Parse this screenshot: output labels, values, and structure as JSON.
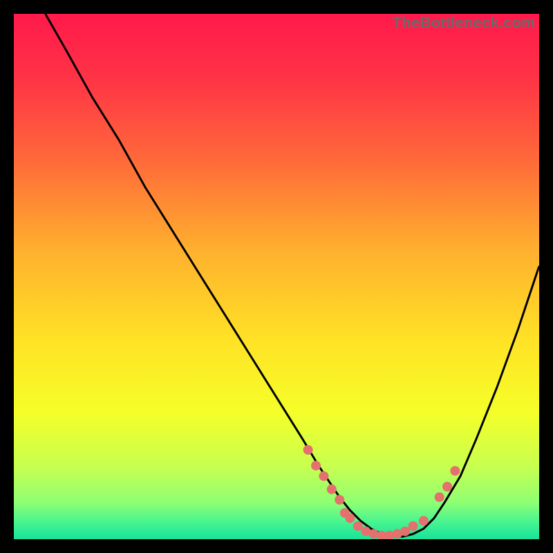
{
  "watermark": "TheBottleneck.com",
  "colors": {
    "background": "#000000",
    "curve": "#000000",
    "dots": "#e4716e",
    "gradient_stops": [
      {
        "offset": 0.0,
        "color": "#ff1a4b"
      },
      {
        "offset": 0.12,
        "color": "#ff3246"
      },
      {
        "offset": 0.28,
        "color": "#ff6a3a"
      },
      {
        "offset": 0.45,
        "color": "#ffb02e"
      },
      {
        "offset": 0.62,
        "color": "#ffe225"
      },
      {
        "offset": 0.76,
        "color": "#f5ff29"
      },
      {
        "offset": 0.86,
        "color": "#c8ff4e"
      },
      {
        "offset": 0.93,
        "color": "#8fff73"
      },
      {
        "offset": 0.965,
        "color": "#4cf58f"
      },
      {
        "offset": 1.0,
        "color": "#18e39a"
      }
    ]
  },
  "chart_data": {
    "type": "line",
    "title": "",
    "xlabel": "",
    "ylabel": "",
    "xlim": [
      0,
      100
    ],
    "ylim": [
      0,
      100
    ],
    "series": [
      {
        "name": "bottleneck-curve",
        "x": [
          6,
          10,
          15,
          20,
          25,
          30,
          35,
          40,
          45,
          50,
          55,
          58,
          60,
          62,
          64,
          66,
          68,
          70,
          72,
          74,
          76,
          78,
          80,
          82,
          85,
          88,
          92,
          96,
          100
        ],
        "y": [
          100,
          93,
          84,
          76,
          67,
          59,
          51,
          43,
          35,
          27,
          19,
          14,
          11,
          8,
          5.5,
          3.5,
          2,
          1,
          0.5,
          0.5,
          1,
          2,
          4,
          7,
          12,
          19,
          29,
          40,
          52
        ]
      }
    ],
    "scatter": [
      {
        "name": "sample-dots",
        "points": [
          {
            "x": 56,
            "y": 17
          },
          {
            "x": 57.5,
            "y": 14
          },
          {
            "x": 59,
            "y": 12
          },
          {
            "x": 60.5,
            "y": 9.5
          },
          {
            "x": 62,
            "y": 7.5
          },
          {
            "x": 63,
            "y": 5
          },
          {
            "x": 64,
            "y": 4
          },
          {
            "x": 65.5,
            "y": 2.5
          },
          {
            "x": 67,
            "y": 1.5
          },
          {
            "x": 68.5,
            "y": 1
          },
          {
            "x": 70,
            "y": 0.7
          },
          {
            "x": 71.5,
            "y": 0.7
          },
          {
            "x": 73,
            "y": 1
          },
          {
            "x": 74.5,
            "y": 1.5
          },
          {
            "x": 76,
            "y": 2.5
          },
          {
            "x": 78,
            "y": 3.5
          },
          {
            "x": 81,
            "y": 8
          },
          {
            "x": 82.5,
            "y": 10
          },
          {
            "x": 84,
            "y": 13
          }
        ]
      }
    ]
  }
}
